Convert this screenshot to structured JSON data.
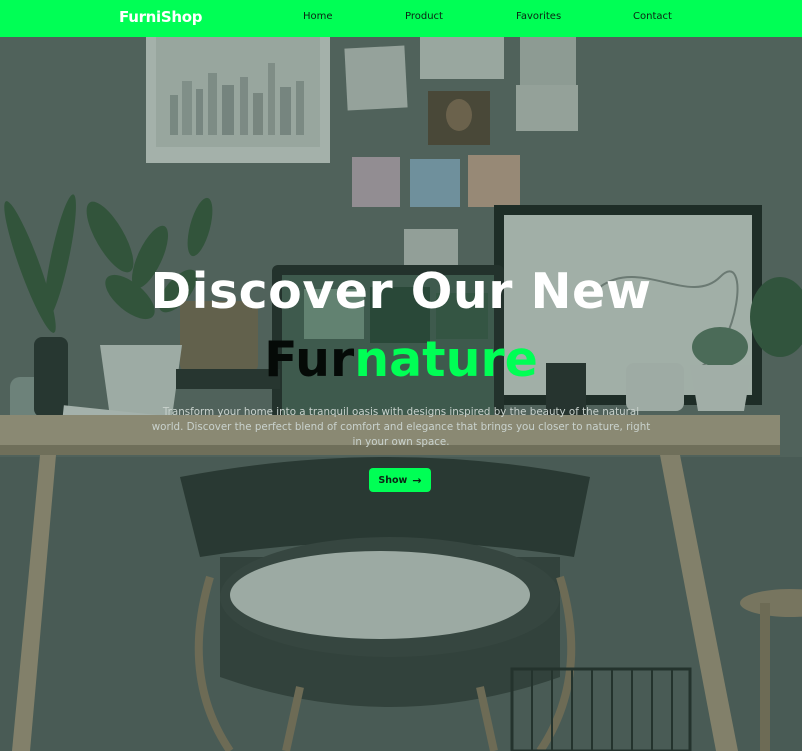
{
  "brand": {
    "name": "FurniShop"
  },
  "nav": {
    "items": [
      {
        "label": "Home"
      },
      {
        "label": "Product"
      },
      {
        "label": "Favorites"
      },
      {
        "label": "Contact"
      }
    ]
  },
  "hero": {
    "title_line1": "Discover Our New",
    "title_part_dark": "Fur",
    "title_part_green": "nature",
    "description": "Transform your home into a tranquil oasis with designs inspired by the beauty of the natural world. Discover the perfect blend of comfort and elegance that brings you closer to nature, right in your own space.",
    "button_label": "Show",
    "button_icon": "arrow-right-icon"
  },
  "colors": {
    "accent": "#00ff55",
    "nav_text": "#0b2414",
    "hero_text": "#ffffff",
    "description_text": "#c9d2cd"
  }
}
